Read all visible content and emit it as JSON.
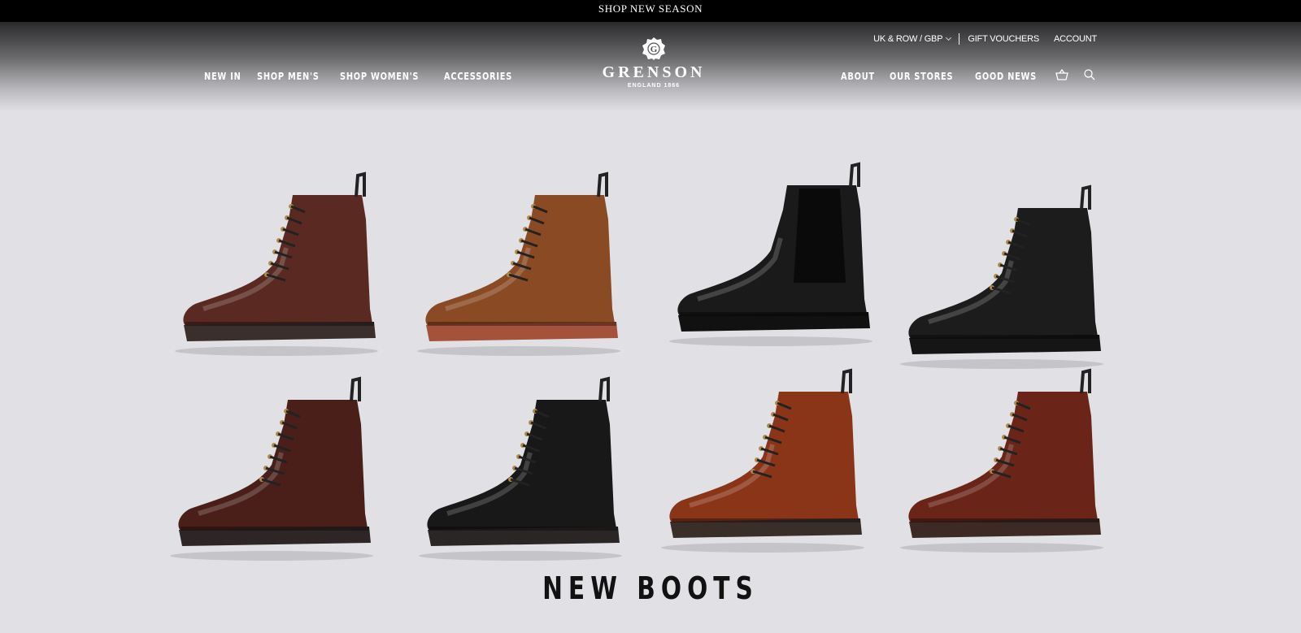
{
  "announcement": {
    "text": "SHOP NEW SEASON"
  },
  "utility": {
    "region": "UK & ROW / GBP",
    "gift": "GIFT VOUCHERS",
    "account": "ACCOUNT"
  },
  "nav_left": [
    "NEW IN",
    "SHOP MEN'S",
    "SHOP WOMEN'S",
    "ACCESSORIES"
  ],
  "nav_right": [
    "ABOUT",
    "OUR STORES",
    "GOOD NEWS"
  ],
  "logo": {
    "name": "GRENSON",
    "tagline": "ENGLAND 1866",
    "monogram": "G"
  },
  "icons": {
    "basket": "basket-icon",
    "search": "search-icon"
  },
  "hero": {
    "title": "NEW BOOTS",
    "boots": [
      {
        "name": "boot-brown-strap",
        "color": "#5a2a22",
        "sole": "#3a2f2b",
        "type": "strap"
      },
      {
        "name": "boot-tan-lace",
        "color": "#8a4a24",
        "sole": "#a5523a",
        "type": "lace"
      },
      {
        "name": "boot-black-chelsea",
        "color": "#1a1a1a",
        "sole": "#111",
        "type": "chelsea"
      },
      {
        "name": "boot-black-shearling",
        "color": "#1c1c1c",
        "sole": "#151515",
        "type": "lace"
      },
      {
        "name": "boot-oxblood-lace",
        "color": "#4a1f1a",
        "sole": "#2e2626",
        "type": "lace"
      },
      {
        "name": "boot-black-hiker",
        "color": "#181818",
        "sole": "#2a2626",
        "type": "lace"
      },
      {
        "name": "boot-red-brown-lace",
        "color": "#8a3418",
        "sole": "#3a2e28",
        "type": "lace"
      },
      {
        "name": "boot-brown-hiker",
        "color": "#6a2418",
        "sole": "#3e2a24",
        "type": "lace"
      }
    ]
  }
}
